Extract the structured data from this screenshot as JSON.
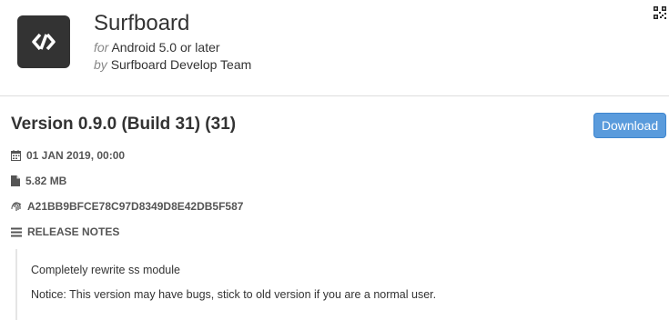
{
  "app": {
    "name": "Surfboard",
    "platform_prefix": "for",
    "platform": "Android 5.0 or later",
    "author_prefix": "by",
    "author": "Surfboard Develop Team"
  },
  "version": {
    "title": "Version 0.9.0 (Build 31) (31)",
    "date": "01 JAN 2019, 00:00",
    "size": "5.82 MB",
    "hash": "A21BB9BFCE78C97D8349D8E42DB5F587"
  },
  "actions": {
    "download_label": "Download"
  },
  "release_notes": {
    "heading": "RELEASE NOTES",
    "lines": [
      "Completely rewrite ss module",
      "Notice: This version may have bugs, stick to old version if you are a normal user."
    ]
  },
  "icons": {
    "app_icon": "surfboard-logo-icon",
    "qr": "qr-code-icon",
    "date": "calendar-icon",
    "size": "file-icon",
    "hash": "fingerprint-icon",
    "notes": "list-icon"
  },
  "colors": {
    "accent": "#5a9bdc",
    "app_icon_bg": "#333333"
  }
}
